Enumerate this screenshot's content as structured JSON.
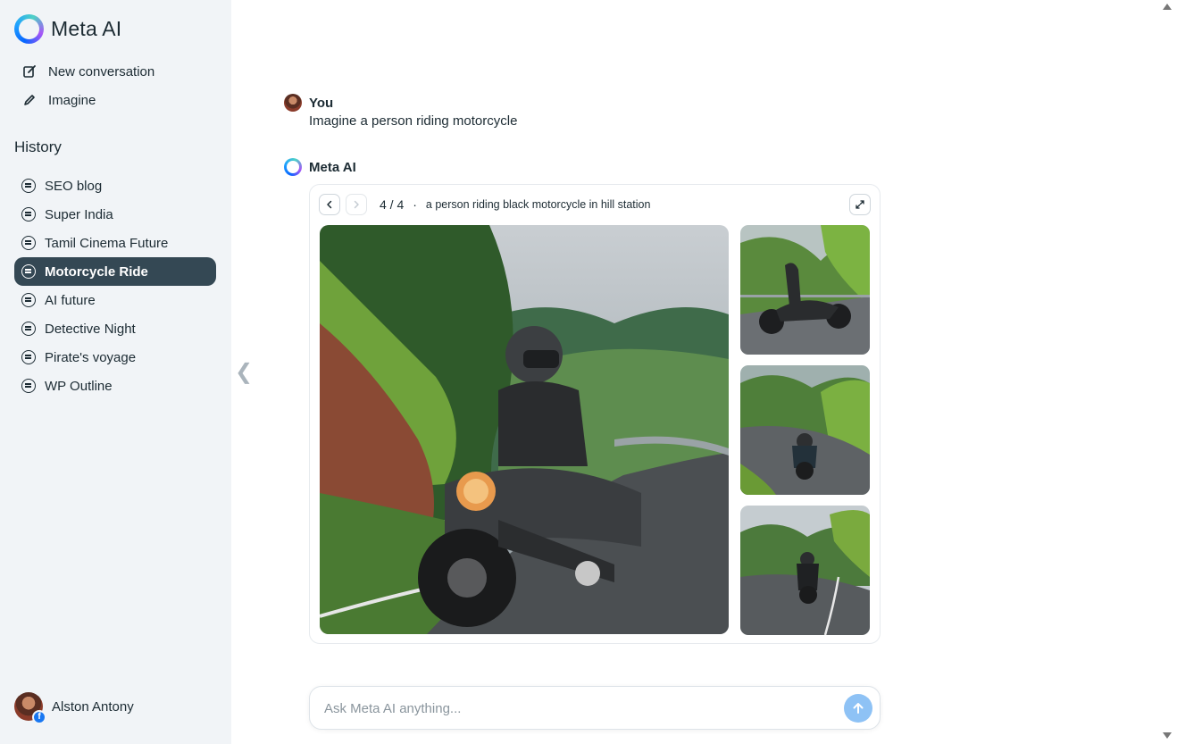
{
  "brand": {
    "name": "Meta AI",
    "icon": "meta-ai-ring-icon"
  },
  "nav": [
    {
      "label": "New conversation",
      "icon": "edit-icon"
    },
    {
      "label": "Imagine",
      "icon": "pencil-icon"
    }
  ],
  "history": {
    "title": "History",
    "items": [
      {
        "label": "SEO blog",
        "active": false
      },
      {
        "label": "Super India",
        "active": false
      },
      {
        "label": "Tamil Cinema Future",
        "active": false
      },
      {
        "label": "Motorcycle Ride",
        "active": true
      },
      {
        "label": "AI future",
        "active": false
      },
      {
        "label": "Detective Night",
        "active": false
      },
      {
        "label": "Pirate's voyage",
        "active": false
      },
      {
        "label": "WP Outline",
        "active": false
      }
    ]
  },
  "user": {
    "name": "Alston Antony",
    "badge": "f"
  },
  "chat": {
    "user_message": {
      "author": "You",
      "text": "Imagine a person riding motorcycle"
    },
    "ai_message": {
      "author": "Meta AI",
      "counter": "4 / 4",
      "separator": "·",
      "caption": "a person riding black motorcycle in hill station"
    }
  },
  "input": {
    "placeholder": "Ask Meta AI anything..."
  },
  "colors": {
    "active_item": "#344854",
    "sidebar_bg": "#f1f4f7",
    "send_button": "#8ec2f5"
  }
}
